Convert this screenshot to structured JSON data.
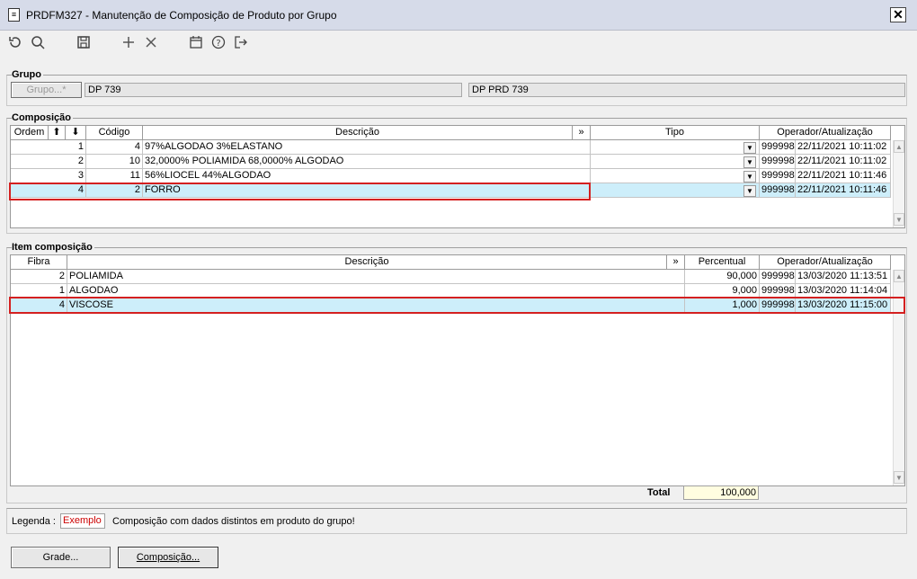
{
  "window": {
    "title": "PRDFM327 - Manutenção de Composição de Produto por Grupo",
    "close": "✕"
  },
  "toolbar": {
    "refresh": "↻",
    "search": "🔍",
    "save": "💾",
    "add": "+",
    "delete": "✕",
    "calendar": "📅",
    "help": "?",
    "exit": "⇥"
  },
  "grupo": {
    "label": "Grupo",
    "button": "Grupo...*",
    "code": "DP 739",
    "name": "DP PRD 739"
  },
  "composicao": {
    "label": "Composição",
    "headers": {
      "ordem": "Ordem",
      "up": "⬆",
      "down": "⬇",
      "codigo": "Código",
      "descricao": "Descrição",
      "expand": "»",
      "tipo": "Tipo",
      "operador": "Operador/Atualização"
    },
    "rows": [
      {
        "ordem": "1",
        "codigo": "4",
        "descricao": "97%ALGODAO 3%ELASTANO",
        "tipo": "",
        "operador": "999998",
        "data": "22/11/2021 10:11:02"
      },
      {
        "ordem": "2",
        "codigo": "10",
        "descricao": "32,0000% POLIAMIDA 68,0000% ALGODAO",
        "tipo": "",
        "operador": "999998",
        "data": "22/11/2021 10:11:02"
      },
      {
        "ordem": "3",
        "codigo": "11",
        "descricao": "56%LIOCEL 44%ALGODAO",
        "tipo": "",
        "operador": "999998",
        "data": "22/11/2021 10:11:46"
      },
      {
        "ordem": "4",
        "codigo": "2",
        "descricao": "FORRO",
        "tipo": "",
        "operador": "999998",
        "data": "22/11/2021 10:11:46"
      }
    ]
  },
  "item": {
    "label": "Item composição",
    "headers": {
      "fibra": "Fibra",
      "descricao": "Descrição",
      "expand": "»",
      "percentual": "Percentual",
      "operador": "Operador/Atualização"
    },
    "rows": [
      {
        "fibra": "2",
        "descricao": "POLIAMIDA",
        "percentual": "90,000",
        "operador": "999998",
        "data": "13/03/2020 11:13:51"
      },
      {
        "fibra": "1",
        "descricao": "ALGODAO",
        "percentual": "9,000",
        "operador": "999998",
        "data": "13/03/2020 11:14:04"
      },
      {
        "fibra": "4",
        "descricao": "VISCOSE",
        "percentual": "1,000",
        "operador": "999998",
        "data": "13/03/2020 11:15:00"
      }
    ],
    "total_label": "Total",
    "total_value": "100,000"
  },
  "legenda": {
    "label": "Legenda :",
    "sample": "Exemplo",
    "text": "Composição com dados distintos em produto do grupo!"
  },
  "footer": {
    "grade": "Grade...",
    "composicao": "Composição..."
  },
  "colors": {
    "selected_row": "#cdeefa",
    "highlight_border": "#d42020",
    "legend_sample": "#cc0000",
    "total_field": "#fffde0"
  }
}
